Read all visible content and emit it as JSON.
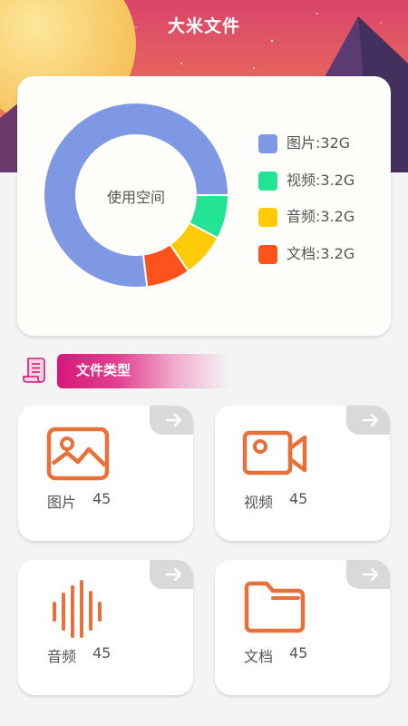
{
  "app": {
    "title": "大米文件"
  },
  "storage": {
    "center_label": "使用空间",
    "legend": [
      {
        "label": "图片:32G",
        "color": "#7f98e4"
      },
      {
        "label": "视频:3.2G",
        "color": "#23e394"
      },
      {
        "label": "音频:3.2G",
        "color": "#fdcb08"
      },
      {
        "label": "文档:3.2G",
        "color": "#fe521d"
      }
    ]
  },
  "chart_data": {
    "type": "pie",
    "categories": [
      "图片",
      "视频",
      "音频",
      "文档"
    ],
    "values": [
      32,
      3.2,
      3.2,
      3.2
    ],
    "units": "G"
  },
  "section": {
    "title": "文件类型",
    "icon": "document-list-icon"
  },
  "file_types": [
    {
      "label": "图片",
      "count": "45",
      "icon": "image-icon",
      "arrow_icon": "arrow-right-icon"
    },
    {
      "label": "视频",
      "count": "45",
      "icon": "video-camera-icon",
      "arrow_icon": "arrow-right-icon"
    },
    {
      "label": "音频",
      "count": "45",
      "icon": "audio-wave-icon",
      "arrow_icon": "arrow-right-icon"
    },
    {
      "label": "文档",
      "count": "45",
      "icon": "folder-icon",
      "arrow_icon": "arrow-right-icon"
    }
  ],
  "colors": {
    "accent": "#e8703a",
    "banner": "#d6187a"
  }
}
